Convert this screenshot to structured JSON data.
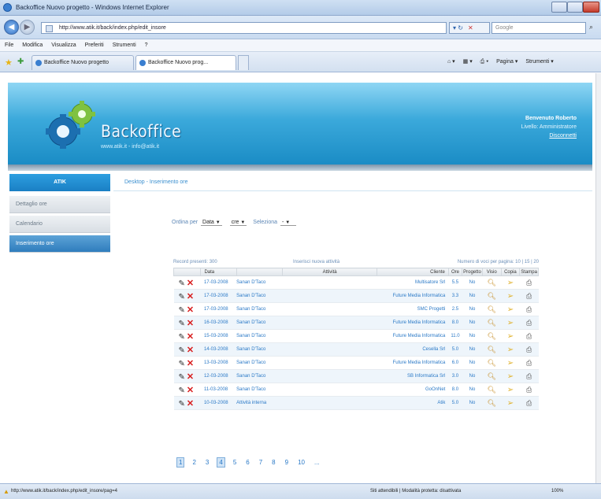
{
  "window": {
    "title": "Backoffice Nuovo progetto - Windows Internet Explorer"
  },
  "address": {
    "url": "http://www.atik.it/back/index.php/edit_insore",
    "search_placeholder": "Google"
  },
  "menu": [
    "File",
    "Modifica",
    "Visualizza",
    "Preferiti",
    "Strumenti",
    "?"
  ],
  "tabs": [
    "Backoffice Nuovo progetto",
    "Backoffice Nuovo prog..."
  ],
  "commandbar": [
    "Pagina ▾",
    "Strumenti ▾"
  ],
  "header": {
    "brand": "Backoffice",
    "brand_sub": "www.atik.it - info@atik.it",
    "welcome": "Benvenuto Roberto",
    "role": "Livello: Amministratore",
    "logout": "Disconnetti"
  },
  "sidebar": {
    "head": "ATIK",
    "items": [
      "Dettaglio ore",
      "Calendario",
      "Inserimento ore"
    ],
    "active_index": 2
  },
  "breadcrumb": "Desktop - Inserimento ore",
  "filters": {
    "order_label": "Ordina per",
    "order_value": "Data",
    "direction_value": "cre",
    "select_label": "Seleziona",
    "select_value": "-"
  },
  "table": {
    "meta_left": "Record presenti: 300",
    "meta_center": "Inserisci nuova attività",
    "meta_right": "Numero di voci per pagina: 10 | 15 | 20",
    "headers": [
      "",
      "Data",
      "",
      "Attività",
      "Cliente",
      "Ore",
      "Progetto",
      "Visio",
      "Copia",
      "Stampa"
    ],
    "rows": [
      {
        "date": "17-03-2008",
        "user": "Sanan D'Taco",
        "activity": "",
        "client": "Multisatore Srl",
        "hours": "5.5",
        "project": "No"
      },
      {
        "date": "17-03-2008",
        "user": "Sanan D'Taco",
        "activity": "",
        "client": "Future Media Informatica",
        "hours": "3.3",
        "project": "No"
      },
      {
        "date": "17-03-2008",
        "user": "Sanan D'Taco",
        "activity": "",
        "client": "SMC Progetti",
        "hours": "2.5",
        "project": "No"
      },
      {
        "date": "16-03-2008",
        "user": "Sanan D'Taco",
        "activity": "",
        "client": "Future Media Informatica",
        "hours": "8.0",
        "project": "No"
      },
      {
        "date": "15-03-2008",
        "user": "Sanan D'Taco",
        "activity": "",
        "client": "Future Media Informatica",
        "hours": "11.0",
        "project": "No"
      },
      {
        "date": "14-03-2008",
        "user": "Sanan D'Taco",
        "activity": "",
        "client": "Cesella Srl",
        "hours": "5.0",
        "project": "No"
      },
      {
        "date": "13-03-2008",
        "user": "Sanan D'Taco",
        "activity": "",
        "client": "Future Media Informatica",
        "hours": "6.0",
        "project": "No"
      },
      {
        "date": "12-03-2008",
        "user": "Sanan D'Taco",
        "activity": "",
        "client": "SB Informatica Srl",
        "hours": "3.0",
        "project": "No"
      },
      {
        "date": "11-03-2008",
        "user": "Sanan D'Taco",
        "activity": "",
        "client": "GoOnNet",
        "hours": "8.0",
        "project": "No"
      },
      {
        "date": "10-03-2008",
        "user": "Attività interna",
        "activity": "",
        "client": "Atik",
        "hours": "5.0",
        "project": "No"
      }
    ]
  },
  "pager": {
    "pages": [
      "1",
      "2",
      "3",
      "4",
      "5",
      "6",
      "7",
      "8",
      "9",
      "10",
      "..."
    ],
    "highlighted": [
      0,
      3
    ]
  },
  "status": {
    "url": "http://www.atik.it/back/index.php/edit_insore/pag=4",
    "zone": "Siti attendibili | Modalità protetta: disattivata",
    "zoom": "100%"
  }
}
